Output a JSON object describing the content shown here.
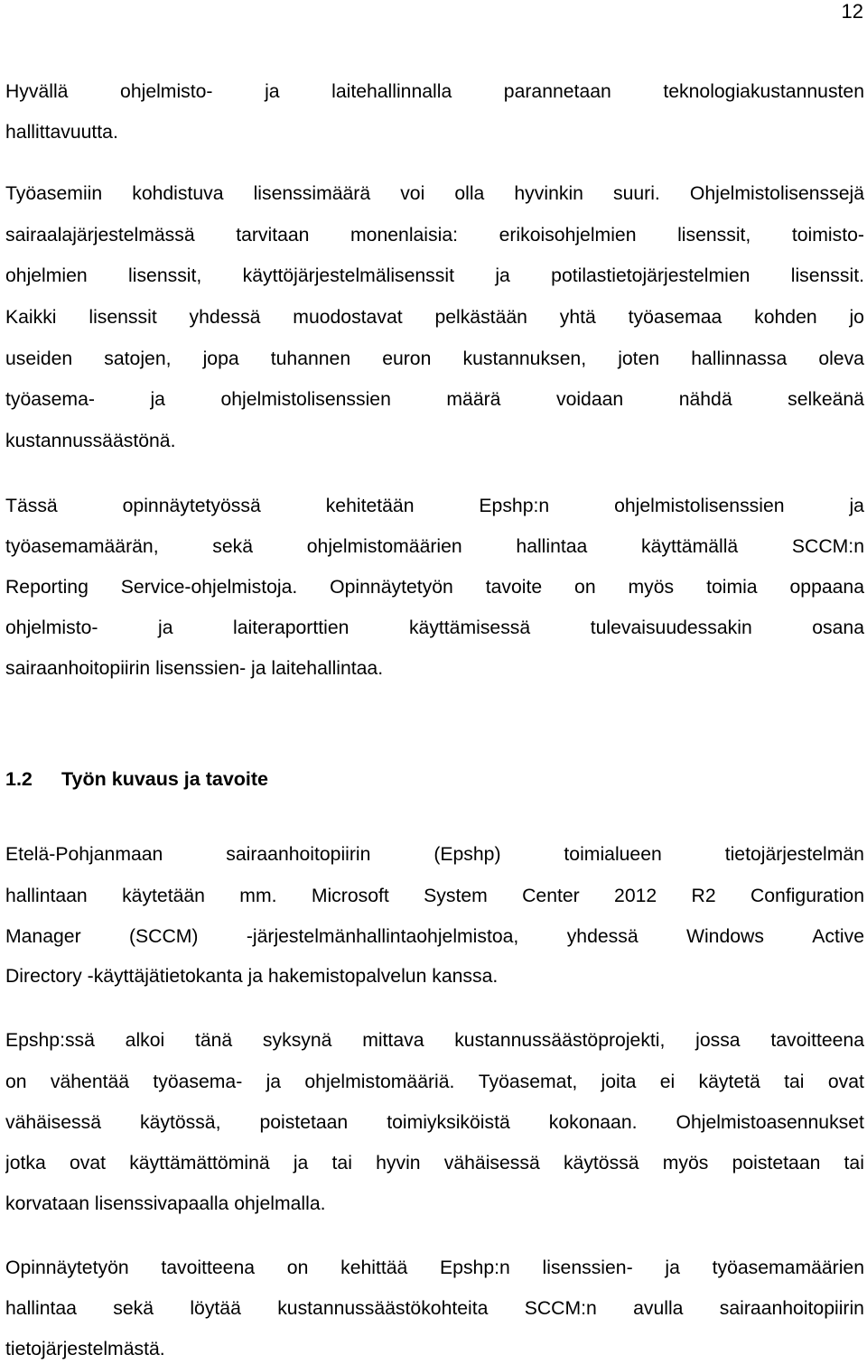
{
  "page_number": "12",
  "paragraphs": [
    {
      "lines": [
        {
          "text": "Hyvällä ohjelmisto- ja laitehallinnalla parannetaan teknologiakustannusten",
          "justify": true
        },
        {
          "text": "hallittavuutta.",
          "justify": false
        }
      ]
    },
    {
      "lines": [
        {
          "text": "Työasemiin kohdistuva lisenssimäärä voi olla hyvinkin suuri. Ohjelmistolisenssejä",
          "justify": true
        },
        {
          "text": "sairaalajärjestelmässä tarvitaan monenlaisia: erikoisohjelmien lisenssit, toimisto-",
          "justify": true
        },
        {
          "text": "ohjelmien lisenssit, käyttöjärjestelmälisenssit ja potilastietojärjestelmien lisenssit.",
          "justify": true
        },
        {
          "text": "Kaikki lisenssit yhdessä muodostavat pelkästään yhtä työasemaa kohden jo",
          "justify": true
        },
        {
          "text": "useiden satojen, jopa tuhannen euron kustannuksen, joten hallinnassa oleva",
          "justify": true
        },
        {
          "text": "työasema- ja ohjelmistolisenssien määrä voidaan nähdä selkeänä",
          "justify": true
        },
        {
          "text": "kustannussäästönä.",
          "justify": false
        }
      ]
    },
    {
      "lines": [
        {
          "text": "Tässä opinnäytetyössä kehitetään Epshp:n ohjelmistolisenssien ja",
          "justify": true
        },
        {
          "text": "työasemamäärän, sekä ohjelmistomäärien hallintaa käyttämällä SCCM:n",
          "justify": true
        },
        {
          "text": "Reporting Service-ohjelmistoja. Opinnäytetyön tavoite on myös toimia oppaana",
          "justify": true
        },
        {
          "text": "ohjelmisto- ja laiteraporttien käyttämisessä tulevaisuudessakin osana",
          "justify": true
        },
        {
          "text": "sairaanhoitopiirin lisenssien- ja laitehallintaa.",
          "justify": false
        }
      ]
    },
    {
      "lines": [
        {
          "text": "Etelä-Pohjanmaan sairaanhoitopiirin (Epshp) toimialueen tietojärjestelmän",
          "justify": true
        },
        {
          "text": "hallintaan käytetään mm. Microsoft System Center 2012 R2 Configuration",
          "justify": true
        },
        {
          "text": "Manager (SCCM) -järjestelmänhallintaohjelmistoa, yhdessä Windows Active",
          "justify": true
        },
        {
          "text": "Directory -käyttäjätietokanta ja hakemistopalvelun kanssa.",
          "justify": false
        }
      ]
    },
    {
      "lines": [
        {
          "text": "Epshp:ssä alkoi tänä syksynä mittava kustannussäästöprojekti, jossa tavoitteena",
          "justify": true
        },
        {
          "text": "on vähentää työasema- ja ohjelmistomääriä. Työasemat, joita ei käytetä tai ovat",
          "justify": true
        },
        {
          "text": "vähäisessä käytössä, poistetaan toimiyksiköistä kokonaan. Ohjelmistoasennukset",
          "justify": true
        },
        {
          "text": "jotka ovat käyttämättöminä ja tai hyvin vähäisessä käytössä myös poistetaan tai",
          "justify": true
        },
        {
          "text": "korvataan lisenssivapaalla ohjelmalla.",
          "justify": false
        }
      ]
    },
    {
      "lines": [
        {
          "text": "Opinnäytetyön tavoitteena on kehittää Epshp:n lisenssien- ja työasemamäärien",
          "justify": true
        },
        {
          "text": "hallintaa sekä löytää kustannussäästökohteita SCCM:n avulla sairaanhoitopiirin",
          "justify": true
        },
        {
          "text": "tietojärjestelmästä.",
          "justify": false
        }
      ]
    }
  ],
  "section_heading": {
    "number": "1.2",
    "title": "Työn kuvaus ja tavoite"
  }
}
